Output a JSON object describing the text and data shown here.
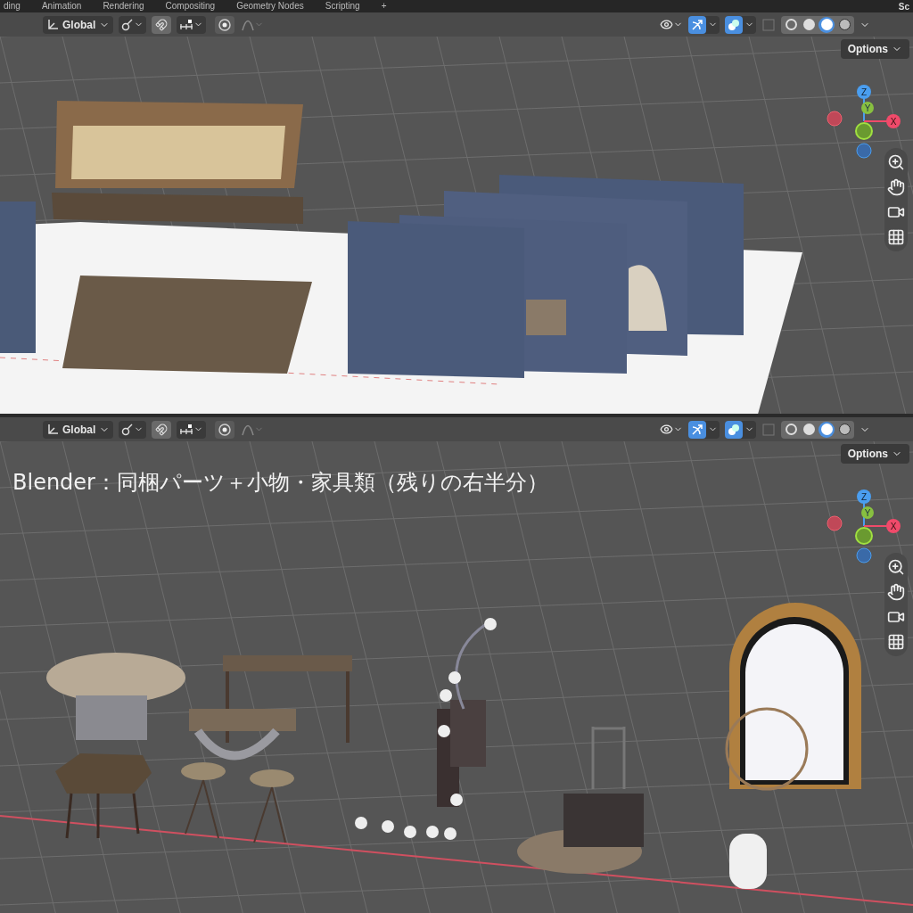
{
  "workspace_tabs": [
    {
      "label": "ding"
    },
    {
      "label": "Animation"
    },
    {
      "label": "Rendering"
    },
    {
      "label": "Compositing"
    },
    {
      "label": "Geometry Nodes"
    },
    {
      "label": "Scripting"
    },
    {
      "label": "+"
    }
  ],
  "workspace_right": "Sc",
  "viewports": [
    {
      "kind": "room",
      "orientation": "Global",
      "gizmos_on": true,
      "overlays_on": true,
      "options": "Options",
      "gizmo": {
        "z": "Z",
        "y": "Y",
        "x": "X"
      },
      "shading_modes": [
        {
          "selected": false
        },
        {
          "selected": false
        },
        {
          "selected": true
        },
        {
          "selected": false
        }
      ]
    },
    {
      "kind": "furniture",
      "orientation": "Global",
      "gizmos_on": true,
      "overlays_on": true,
      "options": "Options",
      "gizmo": {
        "z": "Z",
        "y": "Y",
        "x": "X"
      },
      "shading_modes": [
        {
          "selected": false
        },
        {
          "selected": false
        },
        {
          "selected": true
        },
        {
          "selected": false
        }
      ],
      "caption": "Blender：同梱パーツ＋小物・家具類（残りの右半分）"
    }
  ]
}
